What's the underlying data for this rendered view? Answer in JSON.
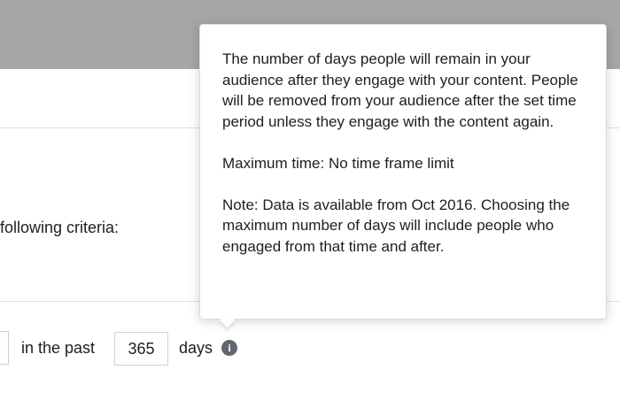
{
  "criteria": {
    "text": "following criteria:"
  },
  "retention": {
    "prefix": "in the past",
    "days_value": "365",
    "suffix": "days",
    "info_icon": "info-icon"
  },
  "tooltip": {
    "paragraph_1": "The number of days people will remain in your audience after they engage with your content. People will be removed from your audience after the set time period unless they engage with the content again.",
    "paragraph_2": "Maximum time: No time frame limit",
    "paragraph_3": "Note: Data is available from Oct 2016. Choosing the maximum number of days will include people who engaged from that time and after."
  },
  "colors": {
    "overlay_bar": "#a6a6a6",
    "text": "#1c1e21",
    "info_icon": "#606770",
    "border": "#ccd0d5"
  }
}
